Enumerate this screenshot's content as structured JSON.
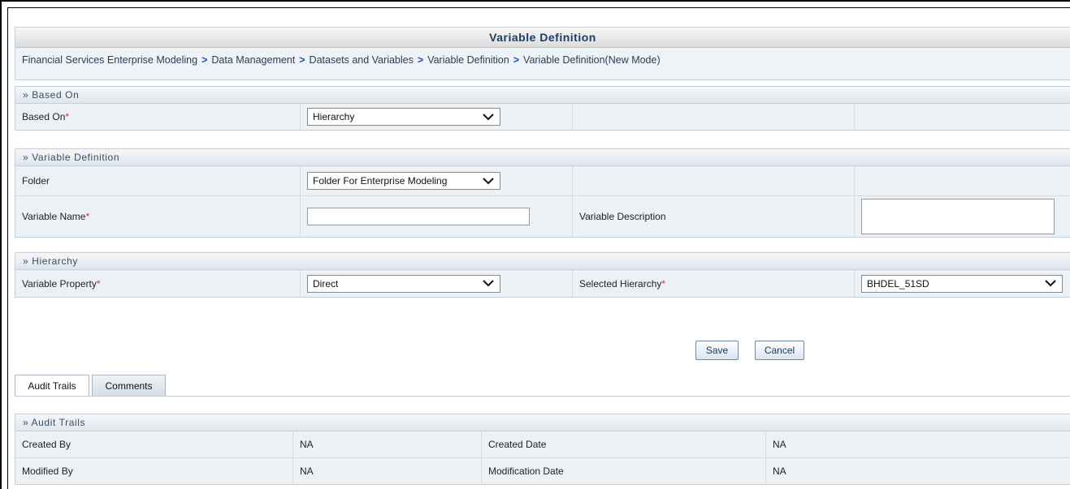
{
  "title": "Variable Definition",
  "breadcrumb": [
    "Financial Services Enterprise Modeling",
    "Data Management",
    "Datasets and Variables",
    "Variable Definition",
    "Variable Definition(New Mode)"
  ],
  "breadcrumb_separator": ">",
  "sections": {
    "based_on": {
      "header": "» Based On",
      "label": "Based On",
      "value": "Hierarchy"
    },
    "variable_definition": {
      "header": "» Variable Definition",
      "folder_label": "Folder",
      "folder_value": "Folder For Enterprise Modeling",
      "name_label": "Variable Name",
      "name_value": "",
      "description_label": "Variable Description",
      "description_value": ""
    },
    "hierarchy": {
      "header": "» Hierarchy",
      "property_label": "Variable Property",
      "property_value": "Direct",
      "selected_label": "Selected Hierarchy",
      "selected_value": "BHDEL_51SD"
    }
  },
  "required_marker": "*",
  "buttons": {
    "save": "Save",
    "cancel": "Cancel"
  },
  "tabs": [
    {
      "label": "Audit Trails",
      "active": true
    },
    {
      "label": "Comments",
      "active": false
    }
  ],
  "audit": {
    "header": "» Audit Trails",
    "created_by_label": "Created By",
    "created_by_value": "NA",
    "created_date_label": "Created Date",
    "created_date_value": "NA",
    "modified_by_label": "Modified By",
    "modified_by_value": "NA",
    "modification_date_label": "Modification Date",
    "modification_date_value": "NA"
  },
  "colors": {
    "accent": "#1f3d63",
    "required": "#d4312d",
    "row_bg": "#ecf1f6"
  }
}
